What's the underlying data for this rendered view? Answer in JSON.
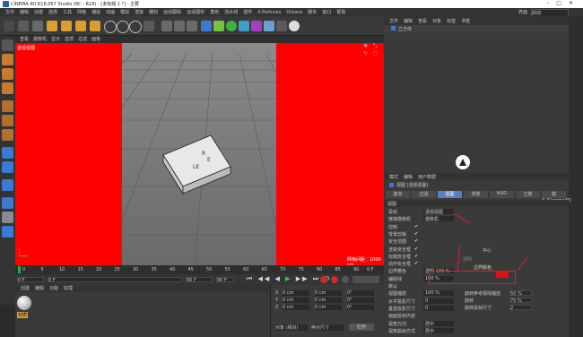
{
  "window": {
    "title": "CINEMA 4D R18.057 Studio (RC - R18) - [未标题 1 *] - 主要"
  },
  "menubar": {
    "items": [
      "文件",
      "编辑",
      "创建",
      "选择",
      "工具",
      "网格",
      "捕捉",
      "动画",
      "模拟",
      "渲染",
      "雕刻",
      "运动跟踪",
      "运动图形",
      "角色",
      "流水线",
      "插件",
      "X-Particles",
      "Octane",
      "脚本",
      "窗口",
      "帮助"
    ],
    "layout_label": "界面",
    "layout_value": "启动"
  },
  "viewport": {
    "menu": [
      "查看",
      "摄像机",
      "显示",
      "选项",
      "过滤",
      "面板"
    ],
    "label": "透视视图",
    "grid_info": "网格间距：1000 cm",
    "model_text": [
      "R",
      "E",
      "LE"
    ]
  },
  "timeline": {
    "ticks": [
      "0",
      "5",
      "10",
      "15",
      "20",
      "25",
      "30",
      "35",
      "40",
      "45",
      "50",
      "55",
      "60",
      "65",
      "70",
      "75",
      "80",
      "85",
      "90"
    ],
    "end_frame": "0 F"
  },
  "transport": {
    "start": "0 F",
    "current": "0 F",
    "end": "90 F",
    "max": "90 F"
  },
  "materials": {
    "menu": [
      "创建",
      "编辑",
      "功能",
      "纹理"
    ],
    "item_label": "材质"
  },
  "coords": {
    "labels": [
      "X",
      "Y",
      "Z"
    ],
    "pos": [
      "0 cm",
      "0 cm",
      "0 cm"
    ],
    "size": [
      "0 cm",
      "0 cm",
      "0 cm"
    ],
    "rot": [
      "0°",
      "0°",
      "0°"
    ],
    "mode1": "对象 (相对)",
    "mode2": "绝对尺寸",
    "apply_button": "应用"
  },
  "objects": {
    "menu": [
      "文件",
      "编辑",
      "查看",
      "对象",
      "标签",
      "书签"
    ],
    "item": "立方体"
  },
  "attributes": {
    "menu": [
      "模式",
      "编辑",
      "用户数据"
    ],
    "object_title": "视图 [透视视图]",
    "tabs": [
      "基本",
      "过滤",
      "视图",
      "背景",
      "HUD",
      "立体",
      "镜头/Cinema4D"
    ],
    "active_tab": "视图",
    "section": "视图",
    "rows": [
      {
        "label": "投射",
        "value": "透视视图"
      },
      {
        "label": "链接摄像机",
        "value": "摄像机"
      },
      {
        "label": "控制",
        "value": "✔"
      },
      {
        "label": "背景剪辑",
        "value": "✔"
      },
      {
        "label": "安全范围",
        "value": "✔"
      },
      {
        "label": "渲染安全框",
        "value": "✔"
      },
      {
        "label": "标题安全框",
        "value": "✔"
      },
      {
        "label": "动作安全框",
        "value": "✔"
      },
      {
        "label": "边界着色",
        "value": "透明 100 %"
      },
      {
        "label": "辅助线",
        "value": "100 %"
      },
      {
        "label": "默认",
        "value": ""
      },
      {
        "label": "视图缩放",
        "value": "100 %"
      },
      {
        "label": "水平投影尺寸",
        "value": "0"
      },
      {
        "label": "垂直投影尺寸",
        "value": "0"
      },
      {
        "label": "画面投射内容",
        "value": ""
      },
      {
        "label": "视角方向",
        "value": "居中"
      },
      {
        "label": "视角投射方式",
        "value": "居中"
      }
    ],
    "border_color_label": "边界颜色",
    "border_color": "#e01010",
    "center_label": "中心",
    "opacity_label": "透明",
    "opacity_value": "100 %",
    "extra_labels": [
      "旋转参考视线缩放",
      "旋转",
      "旋转投射尺寸"
    ],
    "extra_values": [
      "50 %",
      "75 %",
      "2"
    ]
  },
  "colors": {
    "safe_area": "#ff0000",
    "accent": "#3a5a9a",
    "highlight": "#5a7fc0"
  }
}
